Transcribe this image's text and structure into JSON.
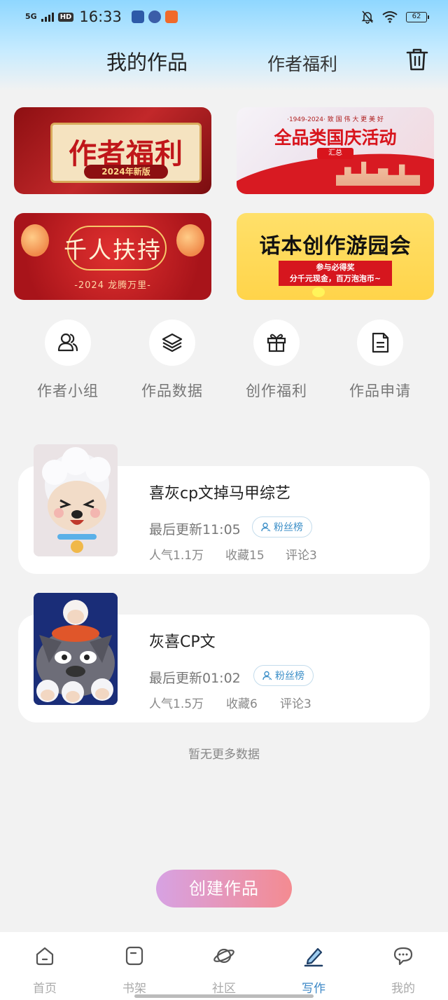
{
  "status_bar": {
    "network": "5G",
    "hd": "HD",
    "time": "16:33",
    "battery": "62"
  },
  "header": {
    "tab_active": "我的作品",
    "tab_other": "作者福利"
  },
  "banners": [
    {
      "title": "作者福利",
      "subtitle": "2024年新版"
    },
    {
      "small": "·1949-2024· 致 国 伟 大 更 美 好",
      "title": "全品类国庆活动",
      "tag": "汇总"
    },
    {
      "title": "千人扶持",
      "subtitle": "-2024 龙腾万里-"
    },
    {
      "title": "话本创作游园会",
      "box_line1": "参与必得奖",
      "box_line2": "分千元现金，百万泡泡币~"
    }
  ],
  "quick_actions": [
    {
      "label": "作者小组",
      "icon": "users-icon"
    },
    {
      "label": "作品数据",
      "icon": "layers-icon"
    },
    {
      "label": "创作福利",
      "icon": "gift-icon"
    },
    {
      "label": "作品申请",
      "icon": "document-icon"
    }
  ],
  "works": [
    {
      "title": "喜灰cp文掉马甲综艺",
      "updated": "最后更新11:05",
      "fans_label": "粉丝榜",
      "popularity": "人气1.1万",
      "favorites": "收藏15",
      "comments": "评论3"
    },
    {
      "title": "灰喜CP文",
      "updated": "最后更新01:02",
      "fans_label": "粉丝榜",
      "popularity": "人气1.5万",
      "favorites": "收藏6",
      "comments": "评论3"
    }
  ],
  "list_end": "暂无更多数据",
  "create_button": "创建作品",
  "bottom_nav": [
    {
      "label": "首页",
      "icon": "home-icon"
    },
    {
      "label": "书架",
      "icon": "bookshelf-icon"
    },
    {
      "label": "社区",
      "icon": "planet-icon"
    },
    {
      "label": "写作",
      "icon": "pen-icon",
      "active": true
    },
    {
      "label": "我的",
      "icon": "chat-icon"
    }
  ],
  "colors": {
    "accent": "#3b87c6",
    "create_gradient_start": "#d7a2e3",
    "create_gradient_end": "#f48b91"
  }
}
